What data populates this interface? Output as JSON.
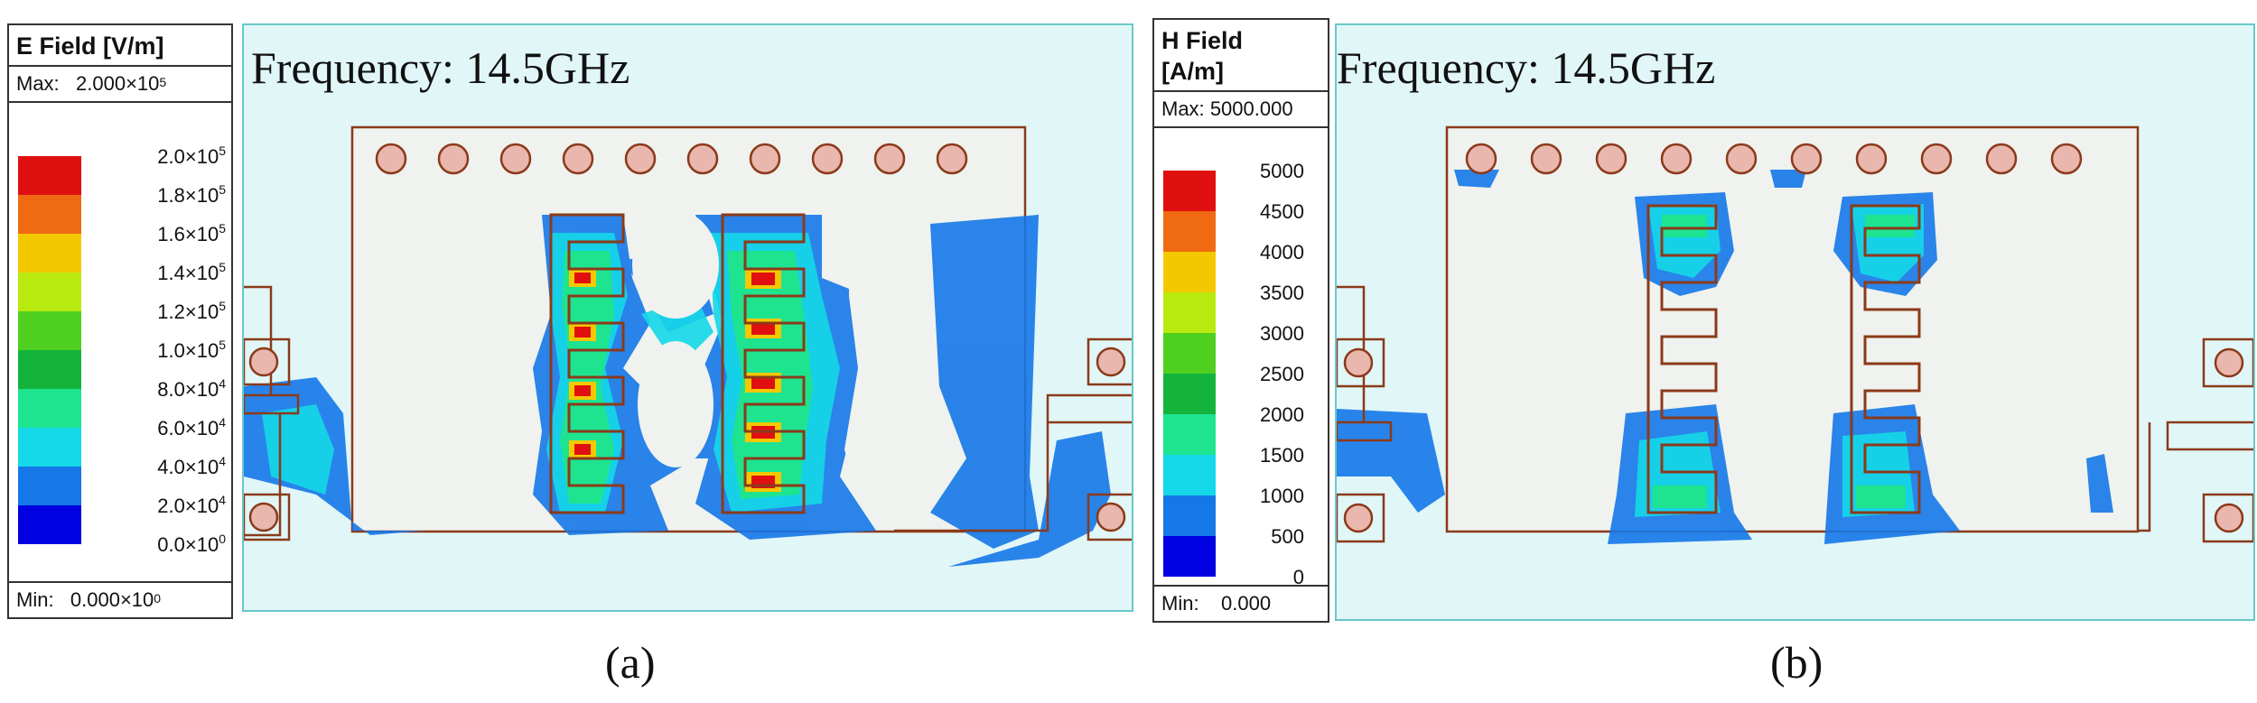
{
  "panels": [
    {
      "id": "a",
      "caption": "(a)",
      "frequency_label": "Frequency: 14.5GHz",
      "legend": {
        "title": "E Field [V/m]",
        "max_label": "Max:",
        "max_value": "2.000×10",
        "max_exp": "5",
        "min_label": "Min:",
        "min_value": "0.000×10",
        "min_exp": "0",
        "ticks": [
          {
            "mant": "2.0×10",
            "exp": "5"
          },
          {
            "mant": "1.8×10",
            "exp": "5"
          },
          {
            "mant": "1.6×10",
            "exp": "5"
          },
          {
            "mant": "1.4×10",
            "exp": "5"
          },
          {
            "mant": "1.2×10",
            "exp": "5"
          },
          {
            "mant": "1.0×10",
            "exp": "5"
          },
          {
            "mant": "8.0×10",
            "exp": "4"
          },
          {
            "mant": "6.0×10",
            "exp": "4"
          },
          {
            "mant": "4.0×10",
            "exp": "4"
          },
          {
            "mant": "2.0×10",
            "exp": "4"
          },
          {
            "mant": "0.0×10",
            "exp": "0"
          }
        ]
      }
    },
    {
      "id": "b",
      "caption": "(b)",
      "frequency_label": "Frequency: 14.5GHz",
      "legend": {
        "title_line1": "H Field",
        "title_line2": "[A/m]",
        "max_label": "Max:",
        "max_value": "5000.000",
        "min_label": "Min:",
        "min_value": "0.000",
        "ticks": [
          "5000",
          "4500",
          "4000",
          "3500",
          "3000",
          "2500",
          "2000",
          "1500",
          "1000",
          "500",
          "0"
        ]
      }
    }
  ],
  "colormap": [
    "#e11010",
    "#f06a14",
    "#f4c800",
    "#b8ea10",
    "#4fd020",
    "#14b43c",
    "#1ee490",
    "#14d8e8",
    "#1478e8",
    "#0000e0"
  ],
  "colors": {
    "plot_bg": "#e1f6f7",
    "plot_border": "#69c8c8",
    "substrate": "#eff2ee",
    "metal_line": "#8b3a1a",
    "via_fill": "#e9b7ae"
  }
}
